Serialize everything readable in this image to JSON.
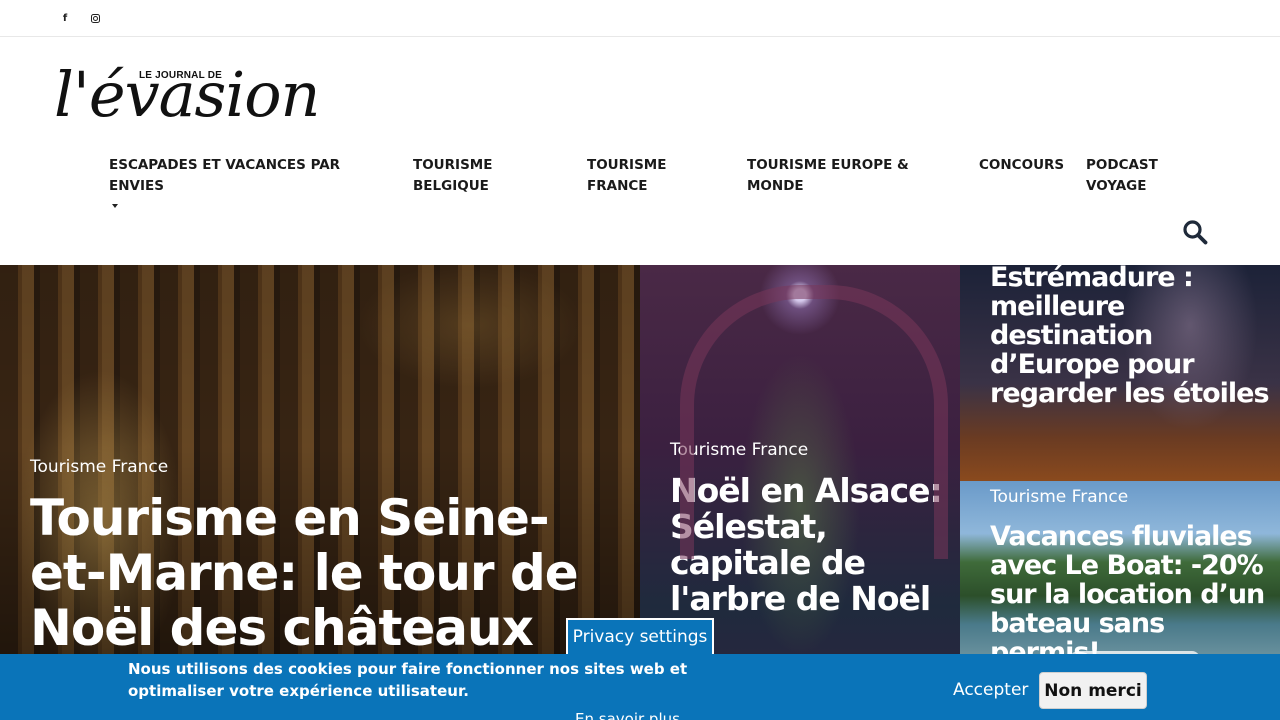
{
  "social": [
    {
      "name": "facebook",
      "icon": "facebook-icon",
      "glyph": "f"
    },
    {
      "name": "instagram",
      "icon": "instagram-icon"
    }
  ],
  "logo": {
    "small": "LE JOURNAL DE",
    "big": "l'évasion"
  },
  "nav": [
    {
      "label": "ESCAPADES ET VACANCES PAR ENVIES",
      "has_dropdown": true
    },
    {
      "label": "TOURISME BELGIQUE"
    },
    {
      "label": "TOURISME FRANCE"
    },
    {
      "label": "TOURISME EUROPE & MONDE"
    },
    {
      "label": "CONCOURS"
    },
    {
      "label": "PODCAST VOYAGE"
    }
  ],
  "search": {
    "icon": "search-icon"
  },
  "hero": {
    "main": {
      "category": "Tourisme France",
      "title": "Tourisme en Seine-et-Marne: le tour de Noël des châteaux"
    },
    "middle": {
      "category": "Tourisme France",
      "title": "Noël en Alsace: Sélestat, capitale de l'arbre de Noël"
    },
    "top_right": {
      "title": "Estrémadure : meilleure destination d’Europe pour regarder les étoiles"
    },
    "bottom_right": {
      "category": "Tourisme France",
      "title": "Vacances fluviales avec Le Boat: -20% sur la location d’un bateau sans permis!"
    }
  },
  "cookie": {
    "privacy_tab": "Privacy settings",
    "text": "Nous utilisons des cookies pour faire fonctionner nos sites web et optimaliser votre expérience utilisateur.",
    "learn_more": "En savoir plus",
    "accept": "Accepter",
    "decline": "Non merci"
  },
  "colors": {
    "cookie_bg": "#0a74b9",
    "text_dark": "#1a1a1a"
  }
}
